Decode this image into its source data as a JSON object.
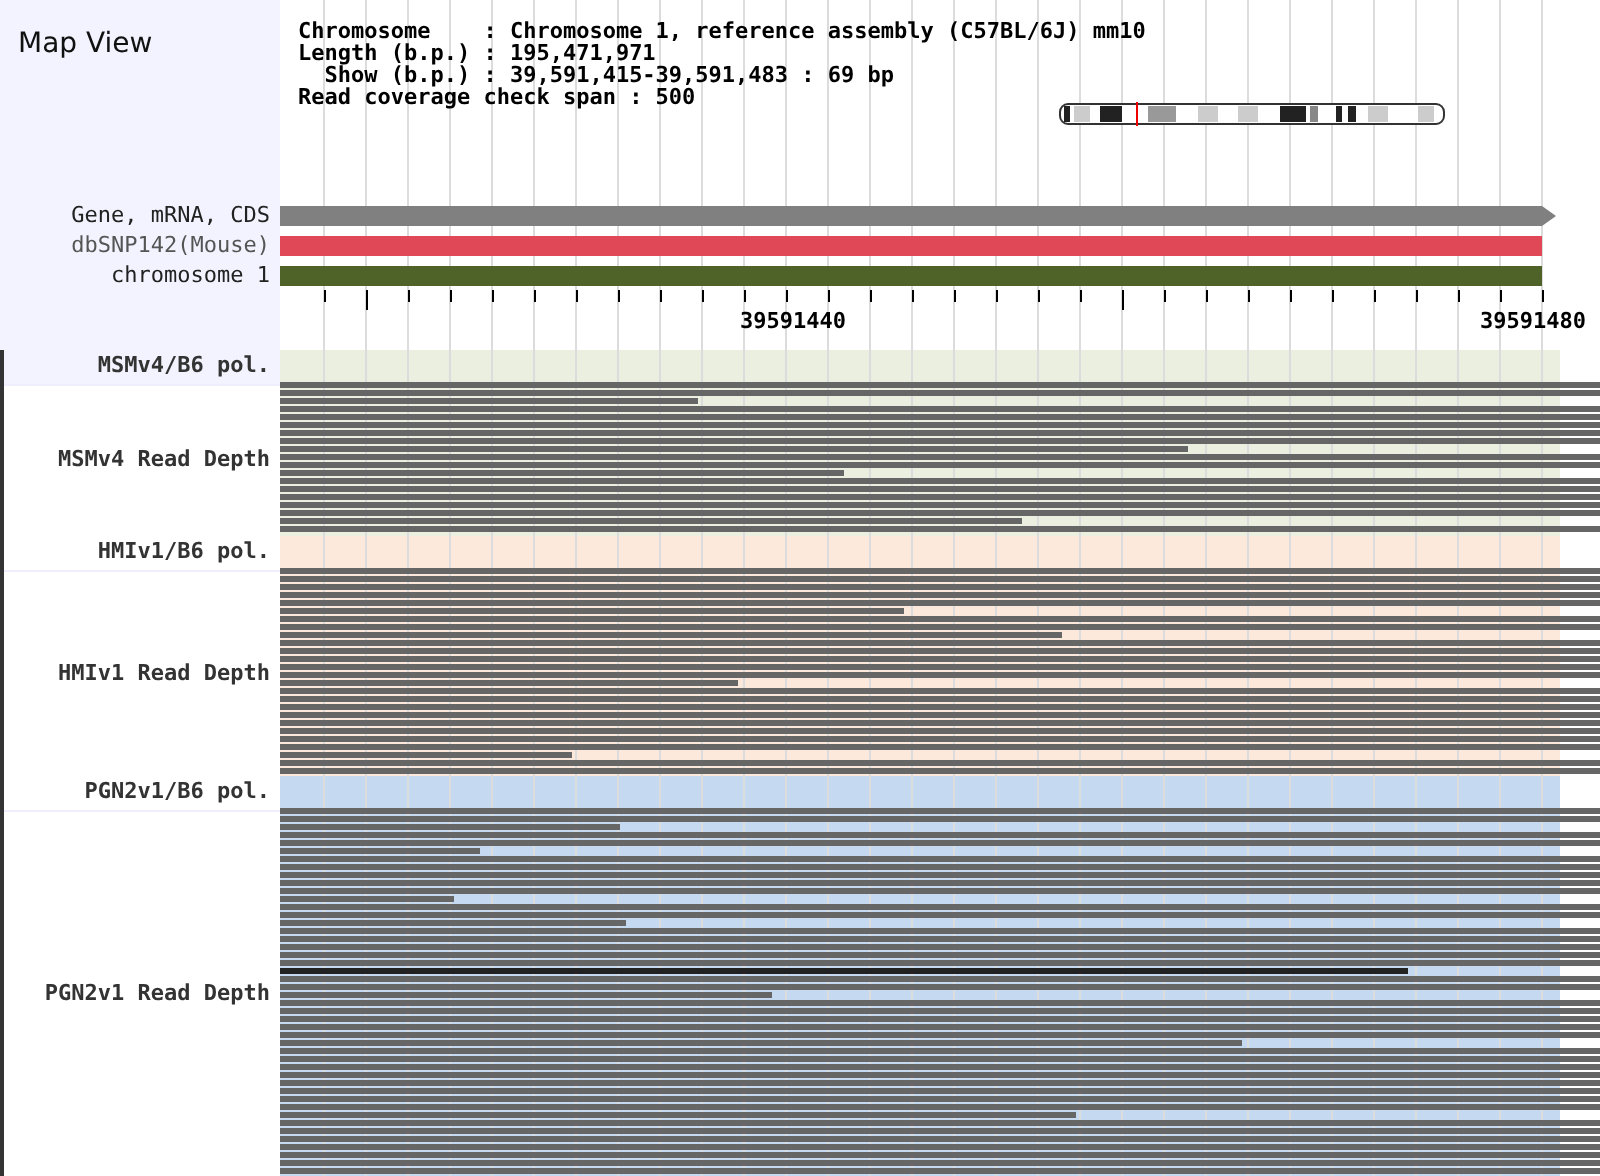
{
  "title": "Map View",
  "info": [
    "Chromosome    : Chromosome 1, reference assembly (C57BL/6J) mm10",
    "Length (b.p.) : 195,471,971",
    "  Show (b.p.) : 39,591,415-39,591,483 : 69 bp",
    "Read coverage check span : 500"
  ],
  "tracks": [
    {
      "label": "Gene, mRNA, CDS",
      "color": "#808080",
      "kind": "arrow"
    },
    {
      "label": "dbSNP142(Mouse)",
      "color": "#e04858",
      "kind": "bar"
    },
    {
      "label": "chromosome 1",
      "color": "#4f6228",
      "kind": "bar"
    }
  ],
  "ruler": {
    "ticks": [
      "39591440",
      "39591480"
    ]
  },
  "strains": [
    {
      "pol_label": "MSMv4/B6 pol.",
      "depth_label": "MSMv4 Read Depth",
      "color": "#ebefe0"
    },
    {
      "pol_label": "HMIv1/B6 pol.",
      "depth_label": "HMIv1 Read Depth",
      "color": "#fde9dc"
    },
    {
      "pol_label": "PGN2v1/B6 pol.",
      "depth_label": "PGN2v1 Read Depth",
      "color": "#c5d9f1"
    }
  ]
}
